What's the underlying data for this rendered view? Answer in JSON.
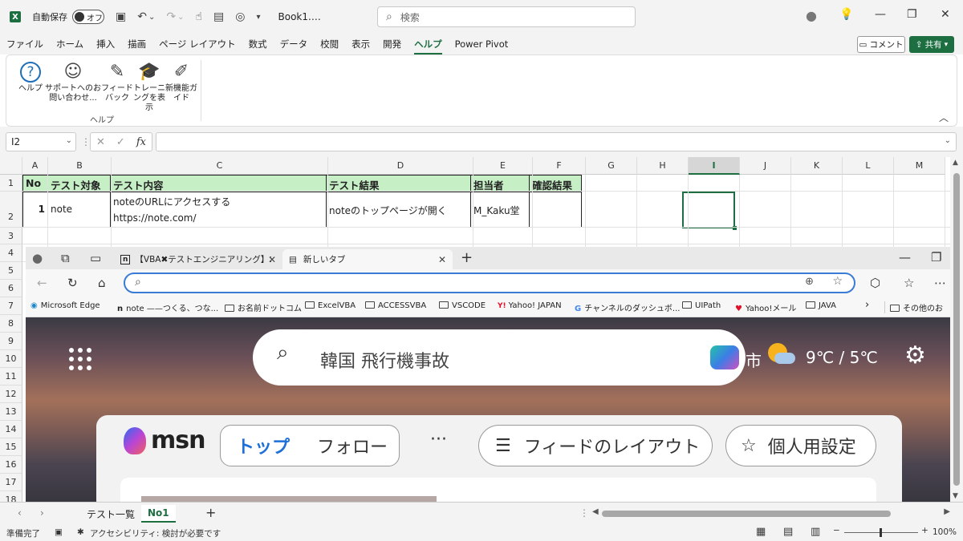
{
  "titlebar": {
    "app_icon": "X",
    "autosave_label": "自動保存",
    "autosave_state": "オフ",
    "book_name": "Book1.…",
    "search_placeholder": "検索"
  },
  "ribbon": {
    "tabs": [
      "ファイル",
      "ホーム",
      "挿入",
      "描画",
      "ページ レイアウト",
      "数式",
      "データ",
      "校閲",
      "表示",
      "開発",
      "ヘルプ",
      "Power Pivot"
    ],
    "active_tab": "ヘルプ",
    "comment_label": "コメント",
    "share_label": "共有",
    "buttons": [
      {
        "icon": "help-icon",
        "glyph": "?",
        "label": "ヘルプ"
      },
      {
        "icon": "support-icon",
        "glyph": "☺",
        "label": "サポートへのお問い合わせ..."
      },
      {
        "icon": "feedback-icon",
        "glyph": "✎",
        "label": "フィードバック"
      },
      {
        "icon": "training-icon",
        "glyph": "🎓",
        "label": "トレーニングを表示"
      },
      {
        "icon": "whatsnew-icon",
        "glyph": "✐",
        "label": "新機能ガイド"
      }
    ],
    "group_label": "ヘルプ"
  },
  "formula_bar": {
    "name_box": "I2",
    "fx": "fx",
    "value": ""
  },
  "grid": {
    "columns": [
      "A",
      "B",
      "C",
      "D",
      "E",
      "F",
      "G",
      "H",
      "I",
      "J",
      "K",
      "L",
      "M"
    ],
    "selected_column": "I",
    "rows": [
      "1",
      "2",
      "3",
      "4",
      "5",
      "6",
      "7",
      "8",
      "9",
      "10",
      "11",
      "12",
      "13",
      "14",
      "15",
      "16",
      "17",
      "18"
    ],
    "header_cells": [
      "No",
      "テスト対象",
      "テスト内容",
      "テスト結果",
      "担当者",
      "確認結果"
    ],
    "data_row": {
      "no": "1",
      "target": "note",
      "content_line1": "noteのURLにアクセスする",
      "content_line2": "https://note.com/",
      "result": "noteのトップページが開く",
      "assignee": "M_Kaku堂",
      "check": ""
    },
    "selected_cell": "I2"
  },
  "browser": {
    "tabs": [
      {
        "label": "【VBA✖テストエンジニアリング】エビデ",
        "active": false
      },
      {
        "label": "新しいタブ",
        "active": true
      }
    ],
    "address_value": "",
    "bookmarks": [
      "Microsoft Edge",
      "note ——つくる、つな...",
      "お名前ドットコム",
      "ExcelVBA",
      "ACCESSVBA",
      "VSCODE",
      "Yahoo! JAPAN",
      "チャンネルのダッシュボ...",
      "UIPath",
      "Yahoo!メール",
      "JAVA",
      "その他のお"
    ],
    "page": {
      "search_query": "韓国 飛行機事故",
      "city_fragment": "市",
      "temps": "9℃ / 5℃",
      "msn_logo": "msn",
      "tab_top": "トップ",
      "tab_follow": "フォロー",
      "more": "···",
      "feed_layout": "フィードのレイアウト",
      "personalize": "個人用設定"
    }
  },
  "sheets": {
    "tabs": [
      "テスト一覧",
      "No1"
    ],
    "active": "No1",
    "add": "+"
  },
  "status": {
    "ready": "準備完了",
    "accessibility": "アクセシビリティ: 検討が必要です",
    "zoom_minus": "−",
    "zoom_plus": "+",
    "zoom": "100%"
  }
}
